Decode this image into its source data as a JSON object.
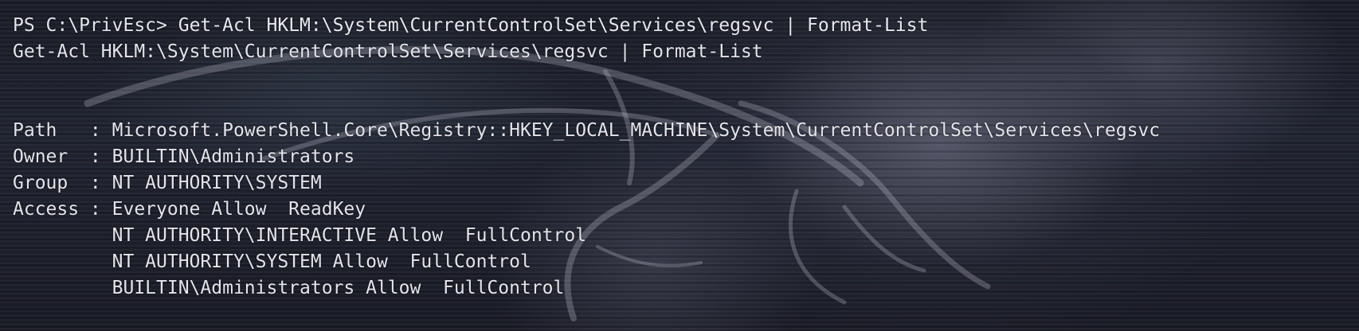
{
  "terminal": {
    "prompt": "PS C:\\PrivEsc> ",
    "command": "Get-Acl HKLM:\\System\\CurrentControlSet\\Services\\regsvc | Format-List",
    "echo": "Get-Acl HKLM:\\System\\CurrentControlSet\\Services\\regsvc | Format-List",
    "output": {
      "path": "Path   : Microsoft.PowerShell.Core\\Registry::HKEY_LOCAL_MACHINE\\System\\CurrentControlSet\\Services\\regsvc",
      "owner": "Owner  : BUILTIN\\Administrators",
      "group": "Group  : NT AUTHORITY\\SYSTEM",
      "access": [
        "Access : Everyone Allow  ReadKey",
        "         NT AUTHORITY\\INTERACTIVE Allow  FullControl",
        "         NT AUTHORITY\\SYSTEM Allow  FullControl",
        "         BUILTIN\\Administrators Allow  FullControl"
      ]
    }
  },
  "background": {
    "icon": "kali-dragon-icon",
    "accent": "#e4e4ea",
    "base": "#1b1d26"
  }
}
